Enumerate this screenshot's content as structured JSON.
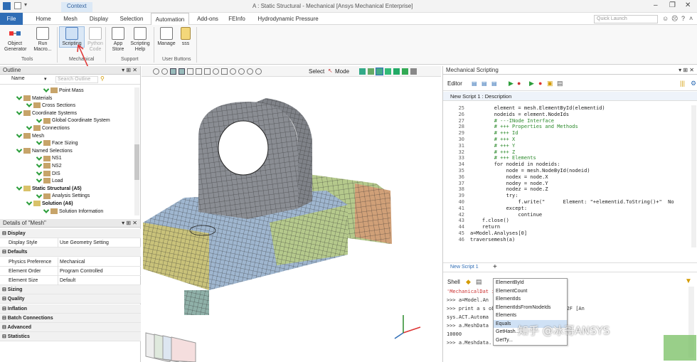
{
  "titlebar": {
    "context": "Context",
    "title": "A : Static Structural - Mechanical [Ansys Mechanical Enterprise]"
  },
  "tabs": [
    "File",
    "Home",
    "Mesh",
    "Display",
    "Selection",
    "Automation",
    "Add-ons",
    "FEInfo",
    "Hydrodynamic Pressure"
  ],
  "active_tab": "Automation",
  "quick_launch_placeholder": "Quick Launch",
  "ribbon": {
    "buttons": [
      {
        "label": "Object\nGenerator"
      },
      {
        "label": "Run\nMacro..."
      },
      {
        "label": "Scripting"
      },
      {
        "label": "Python\nCode"
      },
      {
        "label": "App\nStore"
      },
      {
        "label": "Scripting\nHelp"
      },
      {
        "label": "Manage"
      },
      {
        "label": "sss"
      }
    ],
    "groups": [
      "Tools",
      "Mechanical",
      "Support",
      "User Buttons"
    ]
  },
  "outline": {
    "title": "Outline",
    "name_label": "Name",
    "search_placeholder": "Search Outline",
    "items": [
      {
        "label": "Point Mass",
        "bold": false
      },
      {
        "label": "Materials",
        "bold": false
      },
      {
        "label": "Cross Sections",
        "bold": false
      },
      {
        "label": "Coordinate Systems",
        "bold": false
      },
      {
        "label": "Global Coordinate System",
        "bold": false
      },
      {
        "label": "Connections",
        "bold": false
      },
      {
        "label": "Mesh",
        "bold": false
      },
      {
        "label": "Face Sizing",
        "bold": false
      },
      {
        "label": "Named Selections",
        "bold": false
      },
      {
        "label": "NS1",
        "bold": false
      },
      {
        "label": "NS2",
        "bold": false
      },
      {
        "label": "DIS",
        "bold": false
      },
      {
        "label": "Load",
        "bold": false
      },
      {
        "label": "Static Structural (A5)",
        "bold": true
      },
      {
        "label": "Analysis Settings",
        "bold": false
      },
      {
        "label": "Solution (A6)",
        "bold": true
      },
      {
        "label": "Solution Information",
        "bold": false
      }
    ]
  },
  "details": {
    "title": "Details of \"Mesh\"",
    "rows": [
      {
        "type": "group",
        "label": "Display"
      },
      {
        "type": "prop",
        "key": "Display Style",
        "value": "Use Geometry Setting"
      },
      {
        "type": "group",
        "label": "Defaults"
      },
      {
        "type": "prop",
        "key": "Physics Preference",
        "value": "Mechanical"
      },
      {
        "type": "prop",
        "key": "Element Order",
        "value": "Program Controlled"
      },
      {
        "type": "prop",
        "key": "Element Size",
        "value": "Default"
      },
      {
        "type": "group",
        "label": "Sizing"
      },
      {
        "type": "group",
        "label": "Quality"
      },
      {
        "type": "group",
        "label": "Inflation"
      },
      {
        "type": "group",
        "label": "Batch Connections"
      },
      {
        "type": "group",
        "label": "Advanced"
      },
      {
        "type": "group",
        "label": "Statistics"
      }
    ]
  },
  "viewtool": {
    "select_label": "Select",
    "mode_label": "Mode"
  },
  "scripting": {
    "title": "Mechanical Scripting",
    "editor_label": "Editor",
    "script_tab": "New Script 1 : Description",
    "code_lines": [
      {
        "n": "25",
        "t": "        element = mesh.ElementById(elementid)"
      },
      {
        "n": "26",
        "t": "        nodeids = element.NodeIds"
      },
      {
        "n": "27",
        "t": "        # ---INode Interface"
      },
      {
        "n": "28",
        "t": "        # +++ Properties and Methods"
      },
      {
        "n": "29",
        "t": "        # +++ Id"
      },
      {
        "n": "30",
        "t": "        # +++ X"
      },
      {
        "n": "31",
        "t": "        # +++ Y"
      },
      {
        "n": "32",
        "t": "        # +++ Z"
      },
      {
        "n": "33",
        "t": "        # +++ Elements"
      },
      {
        "n": "34",
        "t": "        for nodeid in nodeids:"
      },
      {
        "n": "35",
        "t": "            node = mesh.NodeById(nodeid)"
      },
      {
        "n": "36",
        "t": "            nodex = node.X"
      },
      {
        "n": "37",
        "t": "            nodey = node.Y"
      },
      {
        "n": "38",
        "t": "            nodez = node.Z"
      },
      {
        "n": "39",
        "t": "            try:"
      },
      {
        "n": "40",
        "t": "                f.write(\"      Element: \"+elementid.ToString()+\"  No"
      },
      {
        "n": "41",
        "t": "            except:"
      },
      {
        "n": "42",
        "t": "                continue"
      },
      {
        "n": "43",
        "t": "    f.close()"
      },
      {
        "n": "44",
        "t": "    return"
      },
      {
        "n": "45",
        "t": "a=Model.Analyses[0]"
      },
      {
        "n": "46",
        "t": "traversemesh(a)"
      }
    ],
    "new_tab": "New Script 1",
    "add_tab": "+",
    "shell_label": "Shell",
    "shell_lines": [
      "'MechanicalDat                              ibute 'Analyses'",
      ">>> a=Model.An",
      ">>> print a                                  s object at 0x000000000000002F [An",
      "sys.ACT.Automa",
      ">>> a.MeshData",
      "10000",
      ">>> a.Meshdata."
    ],
    "autocomplete": [
      "ElementById",
      "ElementCount",
      "ElementIds",
      "ElementIdsFromNodeIds",
      "Elements",
      "Equals",
      "GetHash...",
      "GetTy..."
    ],
    "autocomplete_selected": 5
  },
  "watermark": "知乎 @冰哥ANSYS",
  "colors": {
    "accent": "#2f6db5",
    "mesh_gray": "#8a8d93",
    "mesh_blue": "#9fb6cf",
    "mesh_yellow": "#c9c27a",
    "mesh_green": "#b5c98c",
    "mesh_orange": "#d0a078",
    "arrow_red": "#e03b3b"
  }
}
